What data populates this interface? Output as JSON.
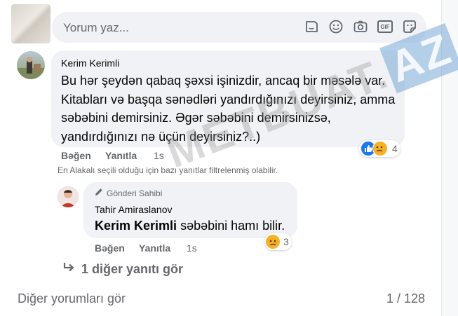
{
  "composer": {
    "placeholder": "Yorum yaz...",
    "icons": [
      "sticker-smile-icon",
      "emoji-icon",
      "camera-icon",
      "gif-icon",
      "sticker-icon"
    ],
    "gif_label": "GIF"
  },
  "comments": [
    {
      "author": "Kerim Kerimli",
      "text": "Bu hər şeydən qabaq şəxsi işinizdir, ancaq bir məsələ var. Kitabları və başqa sənədləri yandırdığınızı deyirsiniz, amma səbəbini demirsiniz. Əgər səbəbini demirsinizsə, yandırdığınızı nə üçün deyirsiniz?..)",
      "actions": {
        "like": "Bəğen",
        "reply": "Yanıtla",
        "time": "1s"
      },
      "reactions": {
        "icons": [
          "like-reaction",
          "sad-reaction"
        ],
        "count": "4"
      }
    }
  ],
  "filter_note": "En Alakalı seçili olduğu için bazı yanıtlar filtrelenmiş olabilir.",
  "reply": {
    "badge": "Gönderi Sahibi",
    "author": "Tahir Amiraslanov",
    "mention": "Kerim Kerimli",
    "text": "səbəbini hamı bilir.",
    "actions": {
      "like": "Bəğen",
      "reply": "Yanıtla",
      "time": "1s"
    },
    "reactions": {
      "icons": [
        "sad-reaction"
      ],
      "count": "3"
    }
  },
  "more_replies": "1 diğer yanıtı gör",
  "more_comments": "Diğer yorumları gör",
  "pager": "1 / 128",
  "watermark": {
    "text": "METBUAT.",
    "box": "AZ"
  },
  "colors": {
    "bubble": "#f0f2f5",
    "secondary": "#65676b",
    "like_blue": "#1877f2",
    "sad_yellow": "#f7b125"
  }
}
